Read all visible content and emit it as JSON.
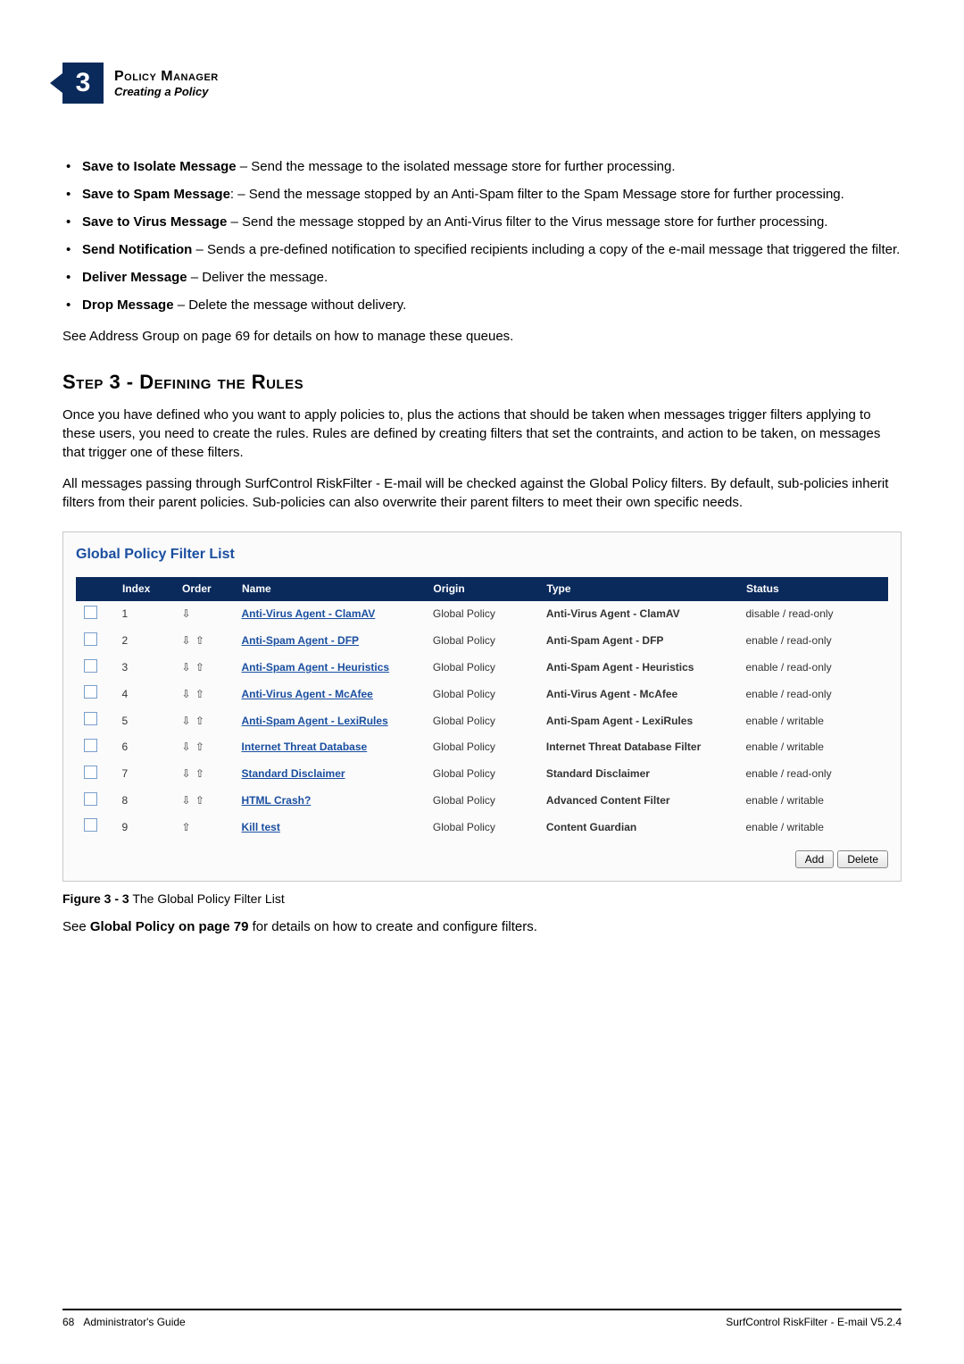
{
  "chapter": {
    "number": "3",
    "title_word1": "Policy",
    "title_word2": "Manager",
    "subtitle": "Creating a Policy"
  },
  "bullets": [
    {
      "term": "Save to Isolate Message",
      "desc": " – Send the message to the isolated message store for further processing."
    },
    {
      "term": "Save to Spam Message",
      "desc": ": – Send the message stopped by an Anti-Spam filter to the Spam Message store for further processing."
    },
    {
      "term": "Save to Virus Message",
      "desc": " – Send the message stopped by an Anti-Virus filter to the Virus message store for further processing."
    },
    {
      "term": "Send Notification",
      "desc": " – Sends a pre-defined notification to specified recipients including a copy of the e-mail message that triggered the filter."
    },
    {
      "term": "Deliver Message",
      "desc": " – Deliver the message."
    },
    {
      "term": "Drop Message",
      "desc": " – Delete the message without delivery."
    }
  ],
  "after_bullets": "See Address Group on page 69 for details on how to manage these queues.",
  "step_heading": "Step 3 - Defining the Rules",
  "step_para1": "Once you have defined who you want to apply policies to, plus the actions that should be taken when messages trigger filters applying to these users, you need to create the rules. Rules are defined by creating filters that set the contraints, and action to be taken, on messages that trigger one of these filters.",
  "step_para2": "All messages passing through SurfControl RiskFilter - E-mail will be checked against the Global Policy filters. By default, sub-policies inherit filters from their parent policies. Sub-policies can also overwrite their parent filters to meet their own specific needs.",
  "panel": {
    "title": "Global Policy Filter List",
    "headers": [
      "",
      "Index",
      "Order",
      "Name",
      "Origin",
      "Type",
      "Status"
    ],
    "rows": [
      {
        "index": "1",
        "order": "down",
        "name": "Anti-Virus Agent - ClamAV",
        "origin": "Global Policy",
        "type": "Anti-Virus Agent - ClamAV",
        "status": "disable / read-only"
      },
      {
        "index": "2",
        "order": "both",
        "name": "Anti-Spam Agent - DFP",
        "origin": "Global Policy",
        "type": "Anti-Spam Agent - DFP",
        "status": "enable / read-only"
      },
      {
        "index": "3",
        "order": "both",
        "name": "Anti-Spam Agent - Heuristics",
        "origin": "Global Policy",
        "type": "Anti-Spam Agent - Heuristics",
        "status": "enable / read-only"
      },
      {
        "index": "4",
        "order": "both",
        "name": "Anti-Virus Agent - McAfee",
        "origin": "Global Policy",
        "type": "Anti-Virus Agent - McAfee",
        "status": "enable / read-only"
      },
      {
        "index": "5",
        "order": "both",
        "name": "Anti-Spam Agent - LexiRules",
        "origin": "Global Policy",
        "type": "Anti-Spam Agent - LexiRules",
        "status": "enable / writable"
      },
      {
        "index": "6",
        "order": "both",
        "name": "Internet Threat Database",
        "origin": "Global Policy",
        "type": "Internet Threat Database Filter",
        "status": "enable / writable"
      },
      {
        "index": "7",
        "order": "both",
        "name": "Standard Disclaimer",
        "origin": "Global Policy",
        "type": "Standard Disclaimer",
        "status": "enable / read-only"
      },
      {
        "index": "8",
        "order": "both",
        "name": "HTML Crash?",
        "origin": "Global Policy",
        "type": "Advanced Content Filter",
        "status": "enable / writable"
      },
      {
        "index": "9",
        "order": "up",
        "name": "Kill test",
        "origin": "Global Policy",
        "type": "Content Guardian",
        "status": "enable / writable"
      }
    ],
    "buttons": {
      "add": "Add",
      "delete": "Delete"
    }
  },
  "figure_caption_bold": "Figure 3 - 3",
  "figure_caption_rest": " The Global Policy Filter List",
  "closing_para_pre": "See ",
  "closing_para_bold": "Global Policy on page 79",
  "closing_para_post": " for details on how to create and configure filters.",
  "footer": {
    "left_page": "68",
    "left_text": "Administrator's Guide",
    "right": "SurfControl RiskFilter - E-mail V5.2.4"
  }
}
